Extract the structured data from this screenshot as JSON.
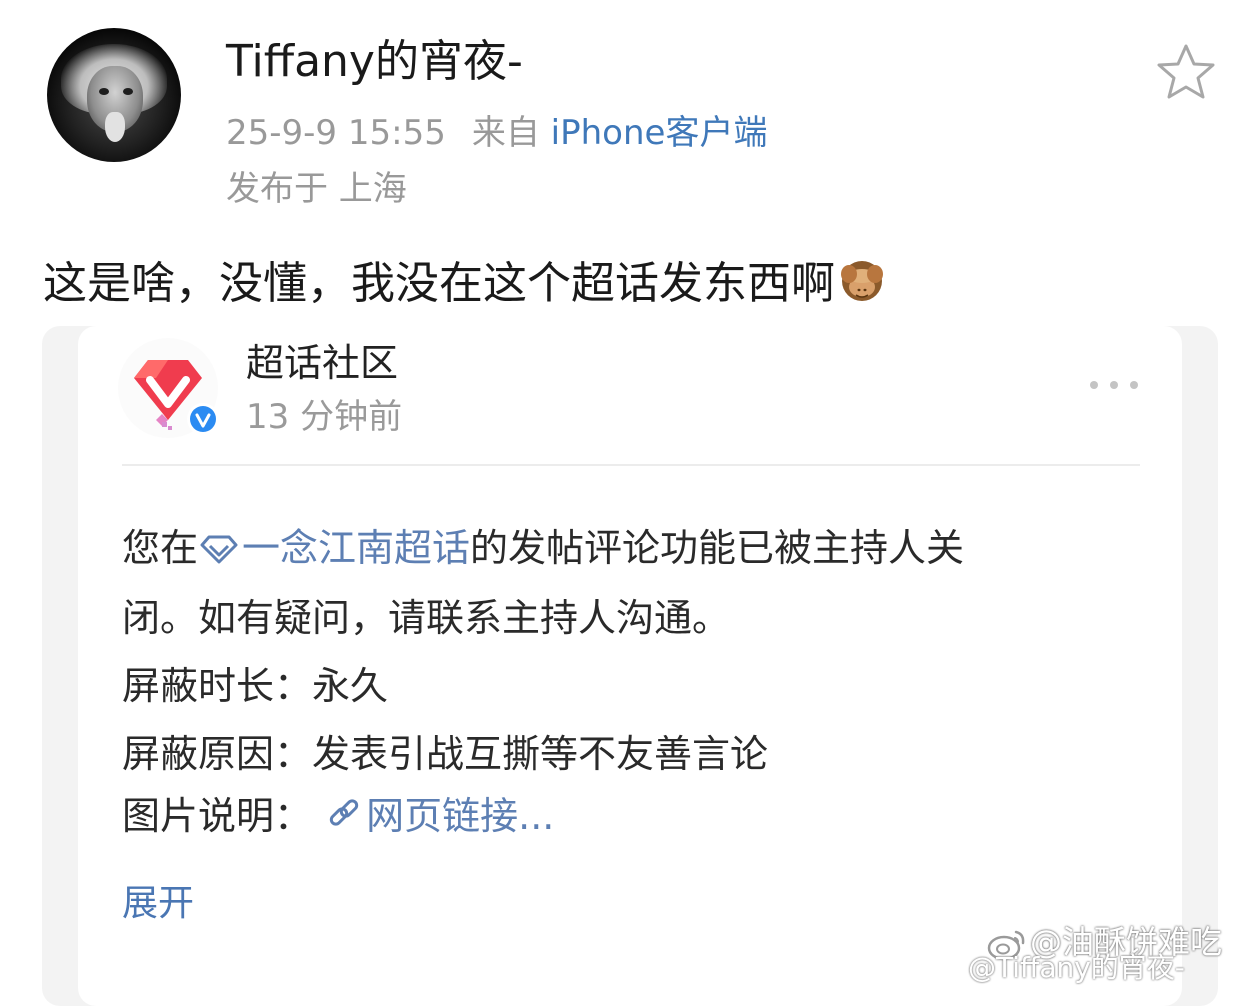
{
  "post": {
    "username": "Tiffany的宵夜-",
    "timestamp": "25-9-9 15:55",
    "from_label": "来自",
    "source": "iPhone客户端",
    "location": "发布于 上海",
    "text": "这是啥，没懂，我没在这个超话发东西啊",
    "emoji": "see-no-evil-monkey",
    "favorite_icon": "star-icon"
  },
  "embedded_notice": {
    "sender_name": "超话社区",
    "time_ago": "13 分钟前",
    "verified_badge": "verified-v-icon",
    "more_icon": "more-dots-icon",
    "message_prefix": "您在",
    "supertopic_link": "一念江南超话",
    "message_line1_suffix": "的发帖评论功能已被主持人关",
    "message_line2": "闭。如有疑问，请联系主持人沟通。",
    "duration_label": "屏蔽时长：",
    "duration_value": "永久",
    "reason_label": "屏蔽原因：",
    "reason_value": "发表引战互撕等不友善言论",
    "image_label": "图片说明：",
    "image_link": "网页链接...",
    "expand_label": "展开"
  },
  "watermark": {
    "primary": "@油酥饼难吃",
    "secondary": "@Tiffany的宵夜-"
  },
  "colors": {
    "link_blue": "#3f78b9",
    "muted_gray": "#999999",
    "card_bg": "#f3f3f3",
    "logo_red": "#f03c4e"
  }
}
